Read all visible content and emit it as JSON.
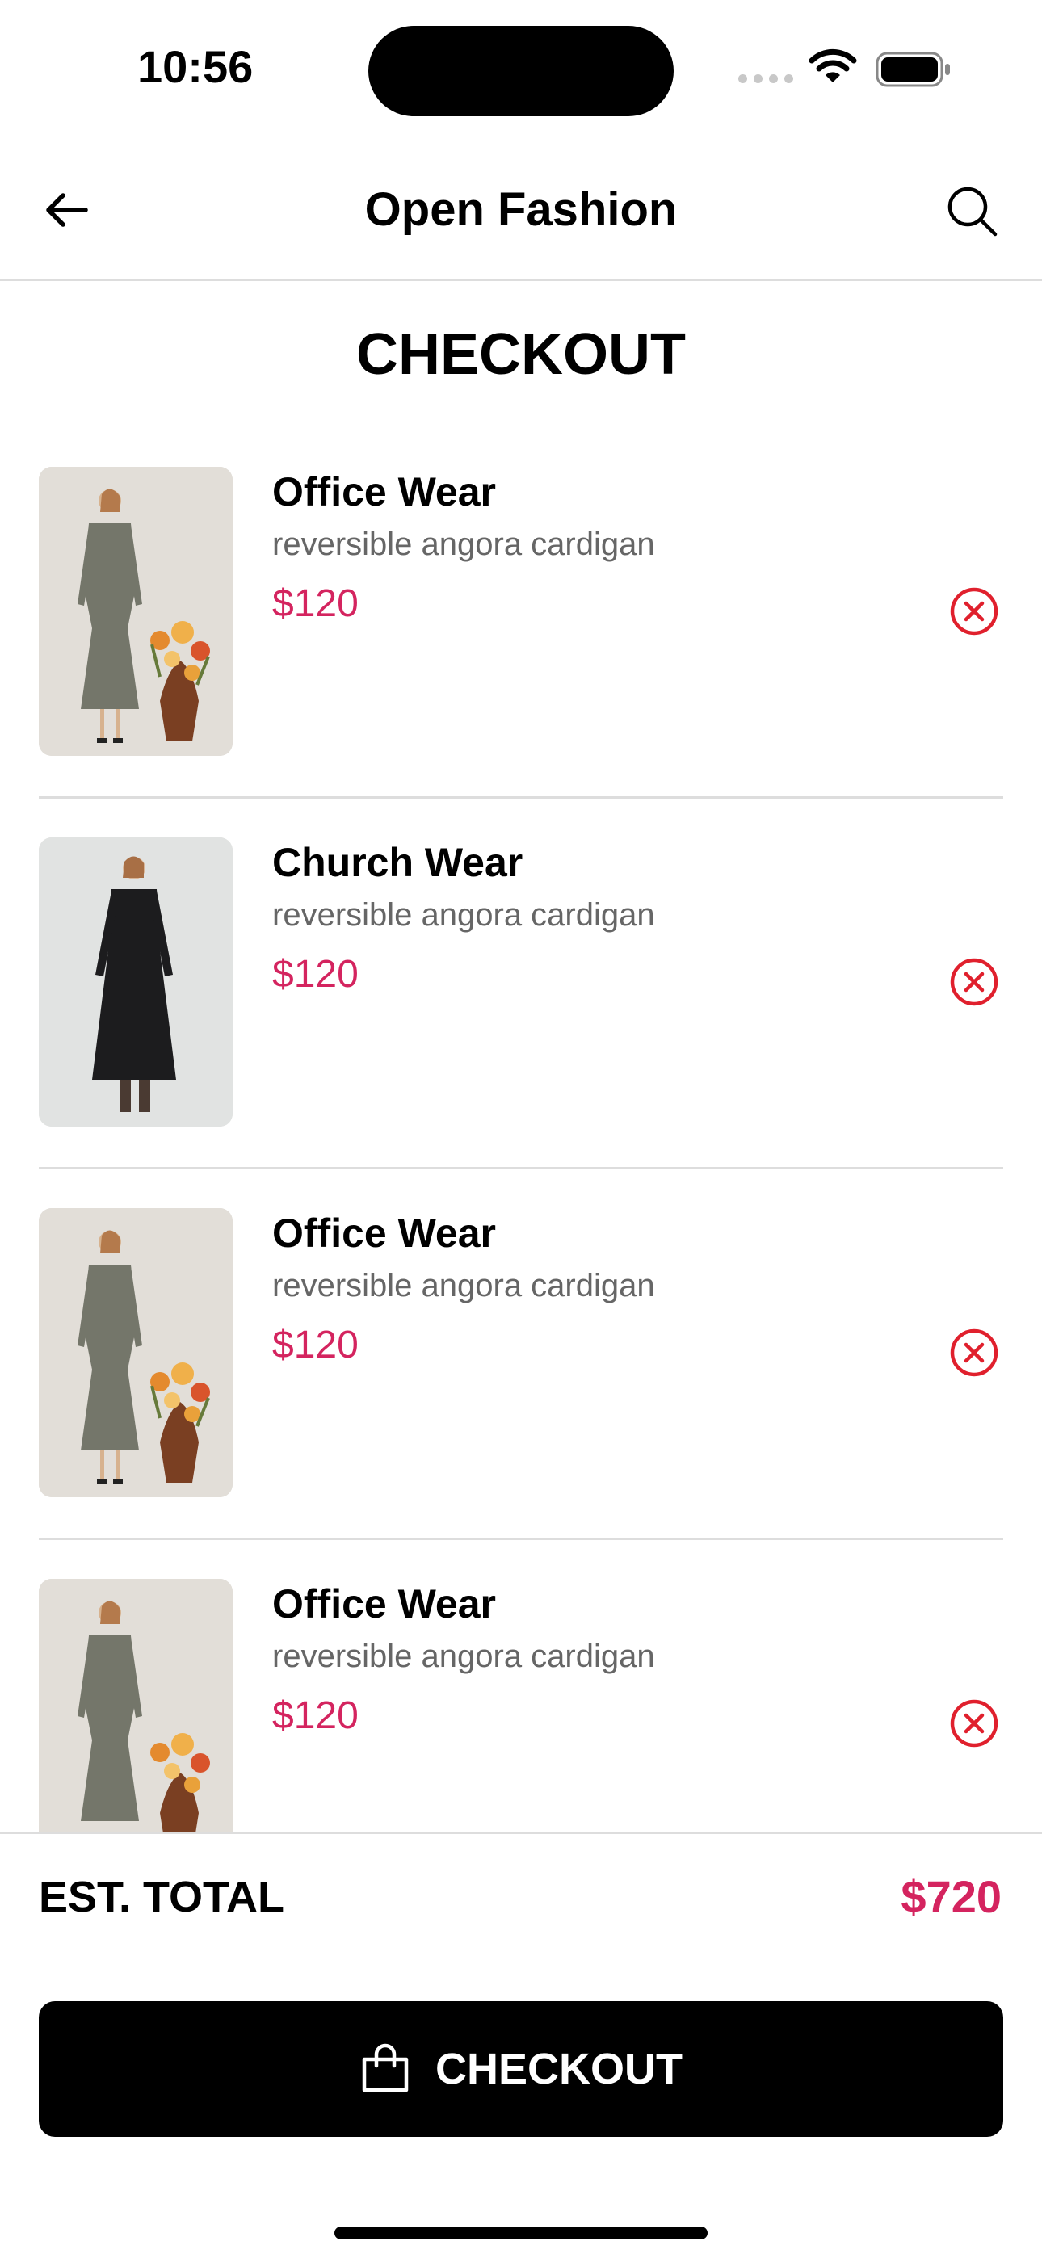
{
  "status_bar": {
    "time": "10:56"
  },
  "nav": {
    "title": "Open Fashion"
  },
  "page": {
    "title": "CHECKOUT"
  },
  "items": [
    {
      "name": "Office Wear",
      "subtitle": "reversible angora cardigan",
      "price": "$120",
      "image": "olive-dress-with-flowers"
    },
    {
      "name": "Church Wear",
      "subtitle": "reversible angora cardigan",
      "price": "$120",
      "image": "black-dress"
    },
    {
      "name": "Office Wear",
      "subtitle": "reversible angora cardigan",
      "price": "$120",
      "image": "olive-dress-with-flowers"
    },
    {
      "name": "Office Wear",
      "subtitle": "reversible angora cardigan",
      "price": "$120",
      "image": "olive-dress-with-flowers"
    }
  ],
  "summary": {
    "label": "EST. TOTAL",
    "value": "$720"
  },
  "checkout_button": {
    "label": "CHECKOUT",
    "icon": "shopping-bag-icon"
  },
  "colors": {
    "accent": "#d4245f",
    "remove_icon": "#e0202d",
    "button": "#000000"
  }
}
